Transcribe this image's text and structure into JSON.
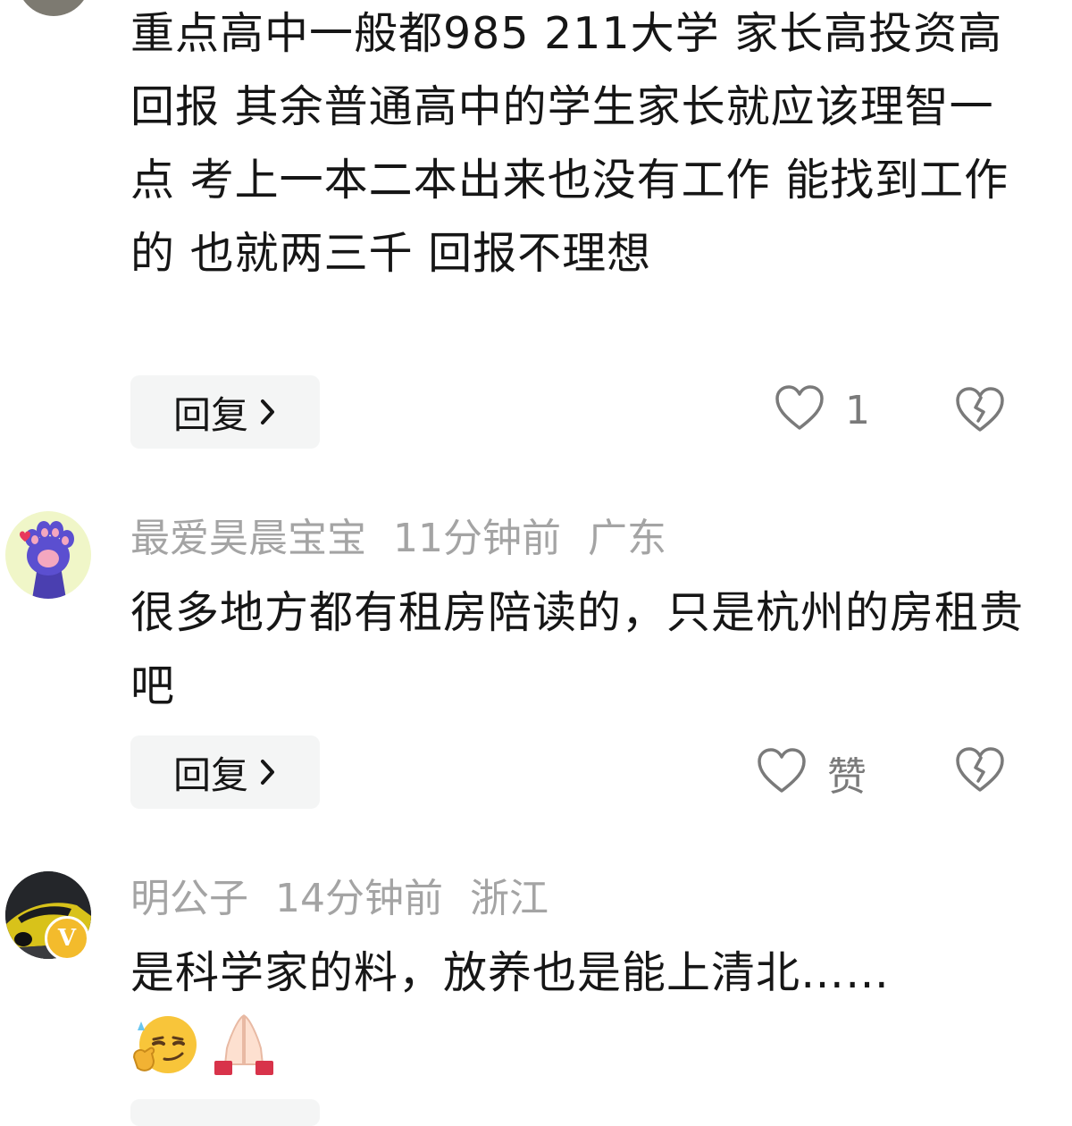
{
  "comments": [
    {
      "text": "重点高中一般都985 211大学 家长高投资高回报 其余普通高中的学生家长就应该理智一点 考上一本二本出来也没有工作 能找到工作的 也就两三千 回报不理想",
      "reply_label": "回复",
      "like_label": "1"
    },
    {
      "username": "最爱昊晨宝宝",
      "time": "11分钟前",
      "location": "广东",
      "text": "很多地方都有租房陪读的，只是杭州的房租贵吧",
      "reply_label": "回复",
      "like_label": "赞"
    },
    {
      "username": "明公子",
      "time": "14分钟前",
      "location": "浙江",
      "badge": "V",
      "text": "是科学家的料，放养也是能上清北……",
      "emojis": [
        "smirk-thumbs-emoji",
        "praying-hands-emoji"
      ]
    }
  ],
  "colors": {
    "text": "#161616",
    "meta": "#a4a4a4",
    "button_bg": "#f4f5f5",
    "icon": "#7a7a7a"
  }
}
